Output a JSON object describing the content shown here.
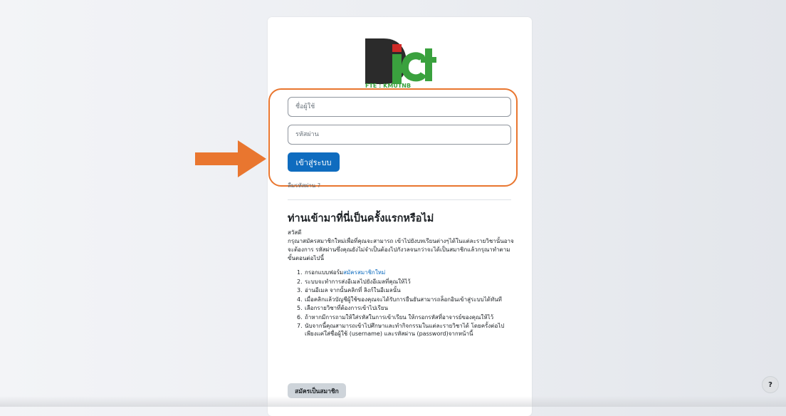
{
  "logo": {
    "main": "ict",
    "tagline": "FTE : KMUTNB",
    "colors": {
      "dark": "#2b2b2b",
      "green": "#3aa13e",
      "red": "#cf2a27"
    }
  },
  "login": {
    "username_placeholder": "ชื่อผู้ใช้",
    "password_placeholder": "รหัสผ่าน",
    "submit_label": "เข้าสู่ระบบ",
    "forgot_label": "ลืมรหัสผ่าน ?"
  },
  "first_time": {
    "title": "ท่านเข้ามาที่นี่เป็นครั้งแรกหรือไม่",
    "greeting": "สวัสดี",
    "intro": "กรุณาสมัครสมาชิกใหม่เพื่อที่คุณจะสามารถ เข้าไปยังบทเรียนต่างๆได้ในแต่ละรายวิชานั้นอาจจะต้องการ รหัสผ่านซึ่งคุณยังไม่จำเป็นต้องไปกังวลจนกว่าจะได้เป็นสมาชิกแล้วกรุณาทำตามขั้นตอนต่อไปนี้",
    "steps": [
      {
        "num": "1.",
        "text": "กรอกแบบฟอร์ม",
        "link": "สมัครสมาชิกใหม่"
      },
      {
        "num": "2.",
        "text": "ระบบจะทำการส่งอีเมลไปยังอีเมลที่คุณให้ไว้"
      },
      {
        "num": "3.",
        "text": "อ่านอีเมล จากนั้นคลิกที่ ลิงก์ในอีเมลนั้น"
      },
      {
        "num": "4.",
        "text": "เมื่อคลิกแล้วบัญชีผู้ใช้ของคุณจะได้รับการยืนยันสามารถล็อกอินเข้าสู่ระบบได้ทันที"
      },
      {
        "num": "5.",
        "text": "เลือกรายวิชาที่ต้องการเข้าไปเรียน"
      },
      {
        "num": "6.",
        "text": "ถ้าหากมีการถามให้ใส่รหัสในการเข้าเรียน ให้กรอกรหัสที่อาจารย์ของคุณให้ไว้"
      },
      {
        "num": "7.",
        "text": "นับจากนี้คุณสามารถเข้าไปศึกษาและทำกิจกรรมในแต่ละรายวิชาได้ โดยครั้งต่อไปเพียงแค่ใส่ชื่อผู้ใช้ (username) และรหัสผ่าน (password)จากหน้านี้"
      }
    ],
    "signup_label": "สมัครเป็นสมาชิก"
  },
  "help_button": {
    "label": "?"
  },
  "colors": {
    "primary": "#0f6cbf",
    "highlight": "#e9762f",
    "arrow": "#e9762f"
  },
  "icons": {
    "arrow": "arrow-right-icon",
    "help": "help-icon"
  }
}
